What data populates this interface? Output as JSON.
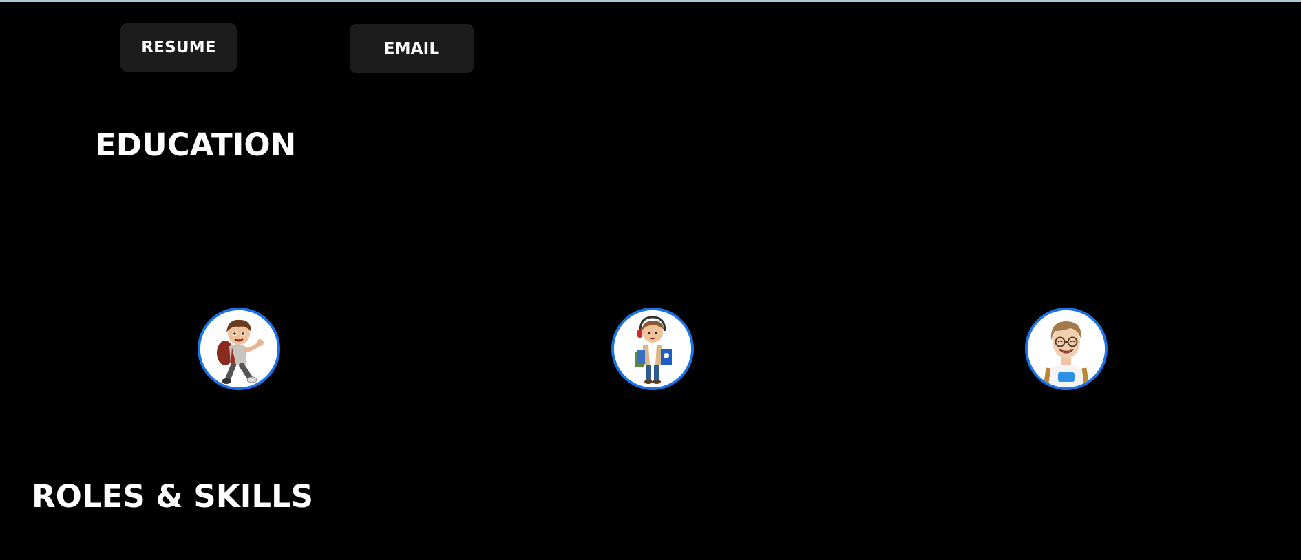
{
  "links": {
    "resume_label": "RESUME",
    "email_label": "EMAIL"
  },
  "sections": {
    "education_title": "EDUCATION",
    "roles_title": "ROLES & SKILLS"
  },
  "education": {
    "avatars": [
      {
        "icon": "walking-boy-backpack-avatar"
      },
      {
        "icon": "student-boy-books-avatar"
      },
      {
        "icon": "smiling-young-man-glasses-avatar"
      }
    ]
  },
  "colors": {
    "background": "#000000",
    "button_bg": "#1c1c1c",
    "text": "#ffffff",
    "avatar_border": "#1a73e8",
    "top_bar": "#a9cdd8"
  }
}
